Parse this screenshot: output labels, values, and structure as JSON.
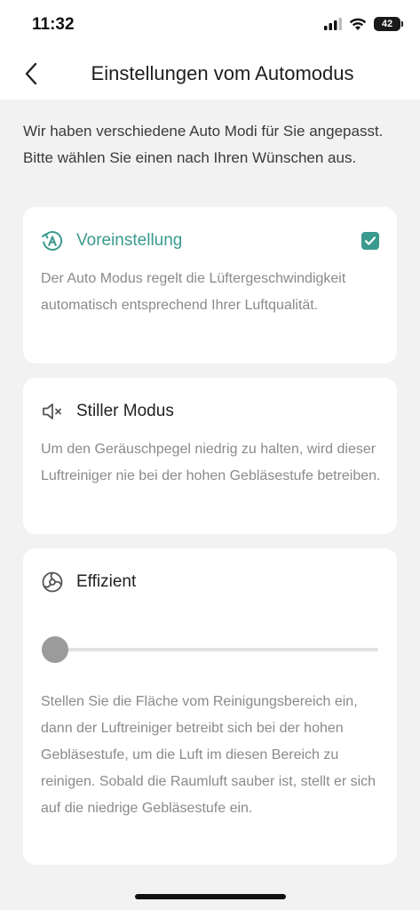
{
  "status_bar": {
    "time": "11:32",
    "battery": "42"
  },
  "nav": {
    "title": "Einstellungen vom Automodus",
    "back_icon": "chevron-left-icon"
  },
  "intro": "Wir haben verschiedene Auto Modi für Sie angepasst. Bitte wählen Sie einen nach Ihren Wünschen aus.",
  "modes": [
    {
      "title": "Voreinstellung",
      "description": "Der Auto Modus regelt die Lüftergeschwindigkeit automatisch entsprechend Ihrer Luftqualität.",
      "icon": "auto-mode-icon",
      "selected": true
    },
    {
      "title": "Stiller Modus",
      "description": "Um den Geräuschpegel niedrig zu halten, wird dieser Luftreiniger nie bei der hohen Gebläsestufe betreiben.",
      "icon": "speaker-mute-icon",
      "selected": false
    },
    {
      "title": "Effizient",
      "description": "Stellen Sie die Fläche vom Reinigungsbereich ein, dann der Luftreiniger betreibt sich bei der hohen Gebläsestufe, um die Luft im diesen Bereich zu reinigen. Sobald die Raumluft sauber ist, stellt er sich auf die niedrige Gebläsestufe ein.",
      "icon": "fan-efficiency-icon",
      "selected": false,
      "slider_value": 0
    }
  ],
  "colors": {
    "accent": "#3a9a8e",
    "background": "#f2f2f2",
    "card": "#ffffff",
    "muted_text": "#8a8a8a"
  }
}
